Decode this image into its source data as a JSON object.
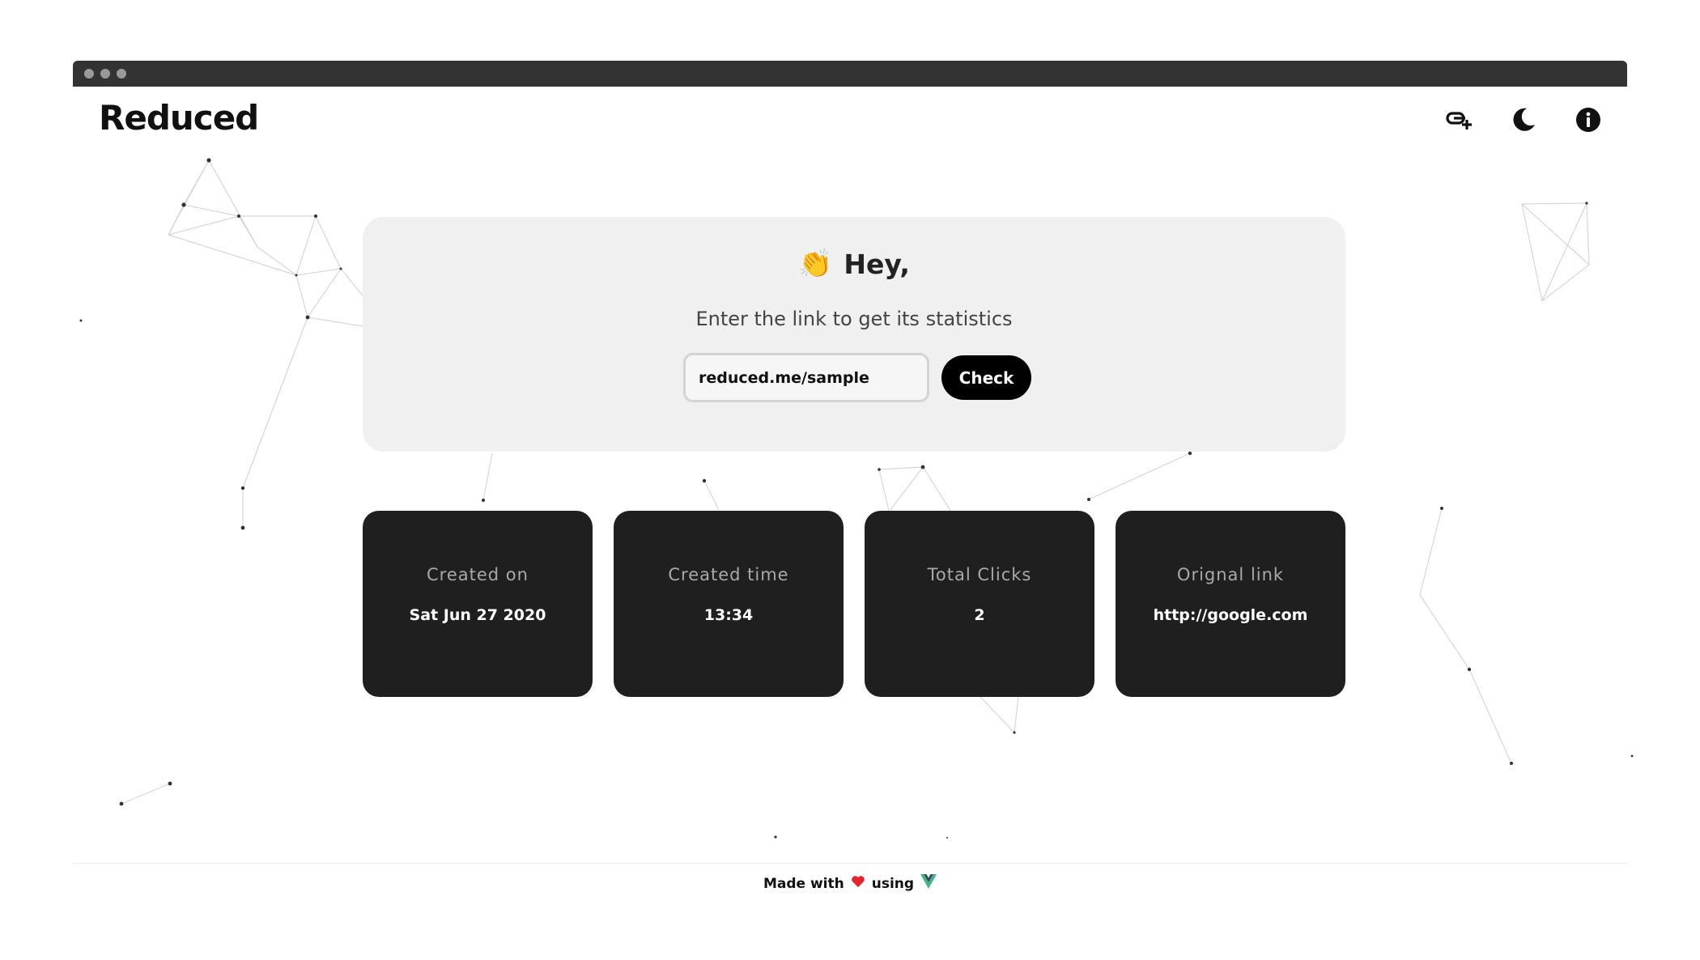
{
  "app": {
    "title": "Reduced"
  },
  "nav": {
    "icons": [
      "add-link-icon",
      "dark-mode-moon-icon",
      "info-icon"
    ]
  },
  "hero": {
    "emoji": "👏",
    "title": "Hey,",
    "subtitle": "Enter the link to get its statistics",
    "input_value": "reduced.me/sample",
    "check_label": "Check"
  },
  "stats": [
    {
      "label": "Created on",
      "value": "Sat Jun 27 2020"
    },
    {
      "label": "Created time",
      "value": "13:34"
    },
    {
      "label": "Total Clicks",
      "value": "2"
    },
    {
      "label": "Orignal link",
      "value": "http://google.com"
    }
  ],
  "footer": {
    "made_with": "Made with",
    "using": "using",
    "heart_icon": "heart-icon",
    "vue_icon": "vue-logo-icon"
  },
  "colors": {
    "card_dark": "#1f1f1f",
    "hero_bg": "#f0f0f0",
    "button_bg": "#000000",
    "heart": "#e5242b",
    "vue_green": "#41b883",
    "vue_dark": "#35495e"
  }
}
